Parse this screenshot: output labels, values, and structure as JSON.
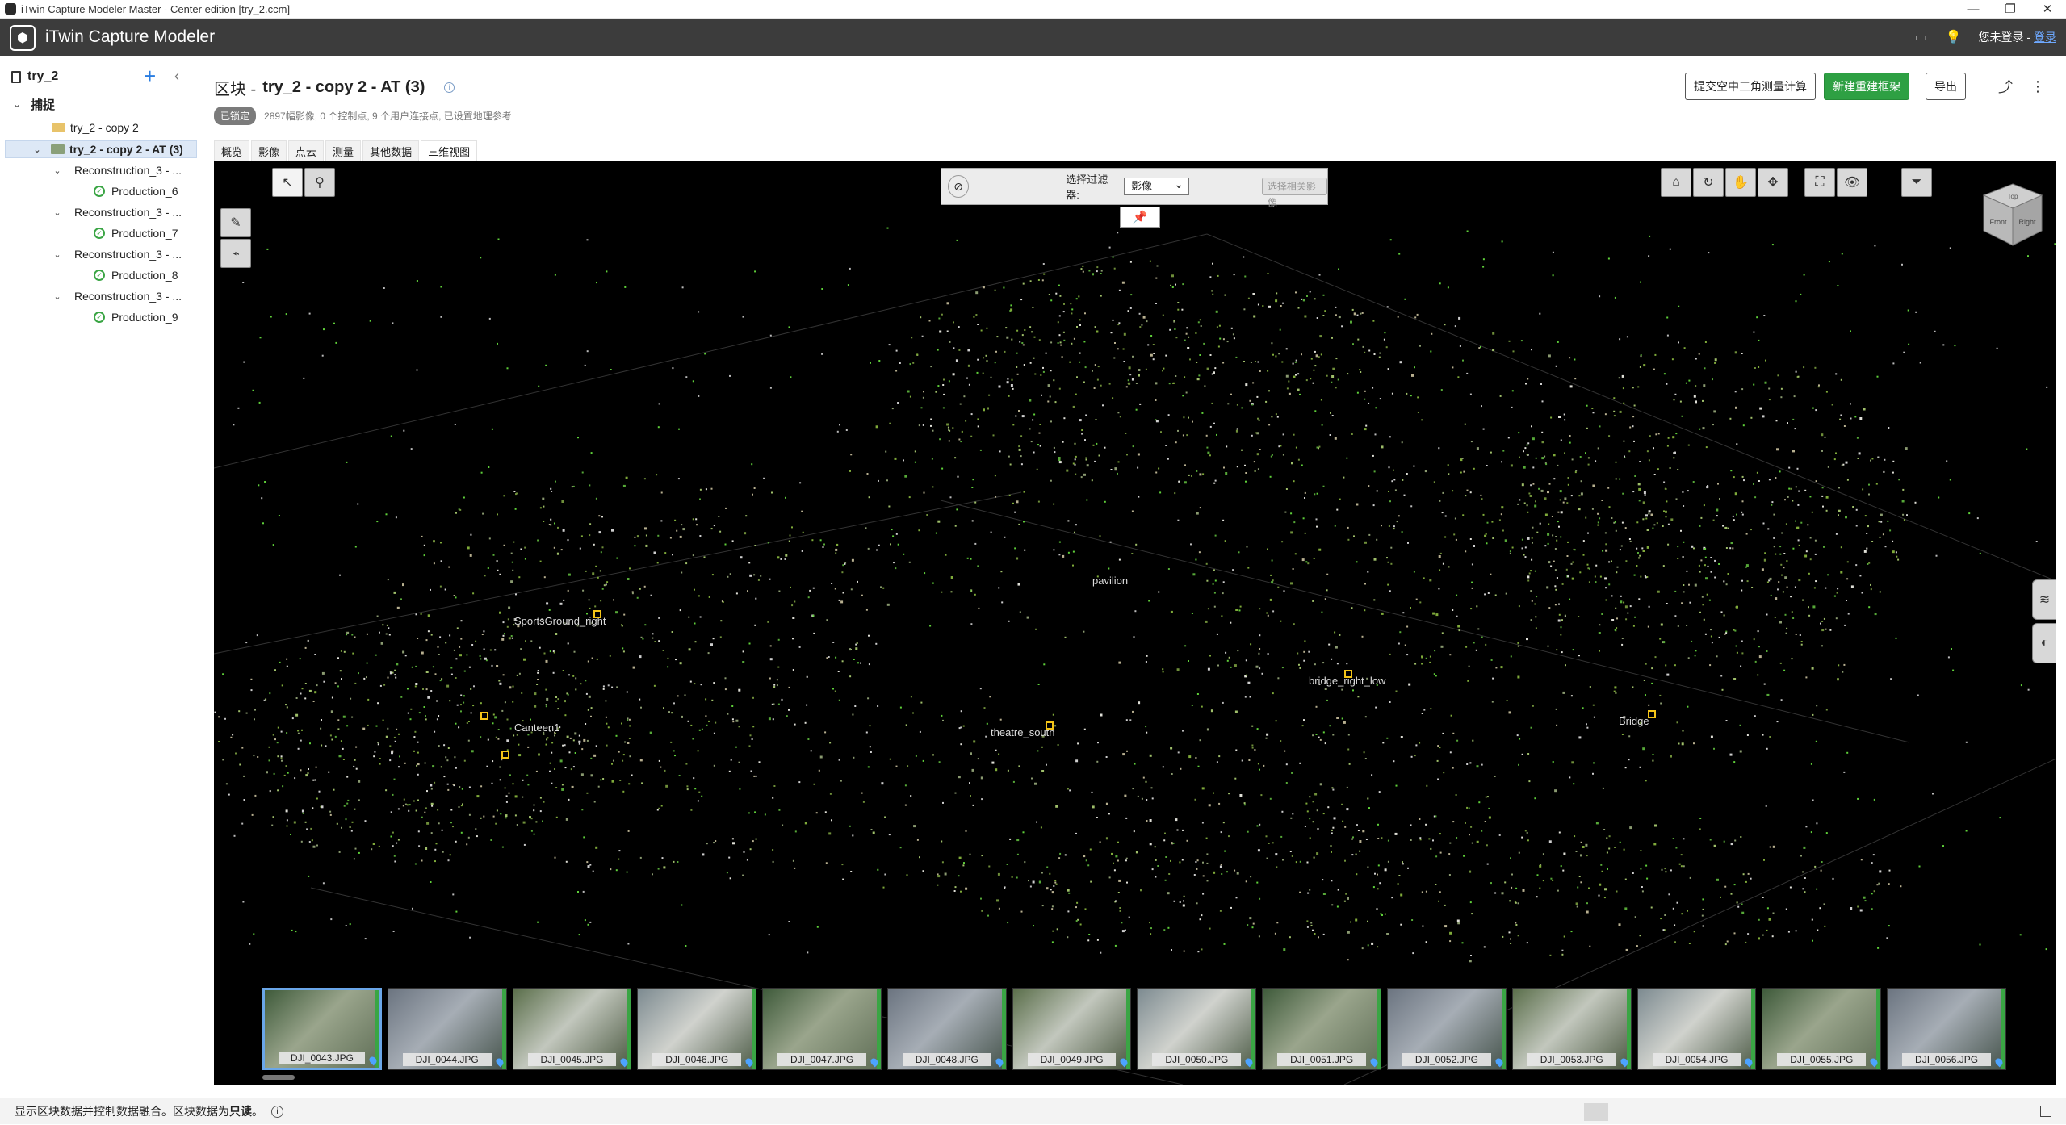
{
  "window": {
    "title": "iTwin Capture Modeler Master - Center edition [try_2.ccm]",
    "controls": [
      "—",
      "❐",
      "✕"
    ]
  },
  "header": {
    "logo_text": "⬢",
    "app_name": "iTwin Capture Modeler",
    "login_prefix": "您未登录 - ",
    "login_link": "登录"
  },
  "sidebar": {
    "project_name": "try_2",
    "add_symbol": "+",
    "collapse_symbol": "‹",
    "tree": [
      {
        "label": "捕捉",
        "level": 0,
        "type": "group"
      },
      {
        "label": "try_2 - copy 2",
        "level": 1,
        "type": "folder"
      },
      {
        "label": "try_2 - copy 2 - AT (3)",
        "level": 1,
        "type": "block",
        "selected": true
      },
      {
        "label": "Reconstruction_3 - ...",
        "level": 2,
        "type": "recon"
      },
      {
        "label": "Production_6",
        "level": 3,
        "type": "production"
      },
      {
        "label": "Reconstruction_3 - ...",
        "level": 2,
        "type": "recon"
      },
      {
        "label": "Production_7",
        "level": 3,
        "type": "production"
      },
      {
        "label": "Reconstruction_3 - ...",
        "level": 2,
        "type": "recon"
      },
      {
        "label": "Production_8",
        "level": 3,
        "type": "production"
      },
      {
        "label": "Reconstruction_3 - ...",
        "level": 2,
        "type": "recon"
      },
      {
        "label": "Production_9",
        "level": 3,
        "type": "production"
      }
    ]
  },
  "block": {
    "title_prefix": "区块 -",
    "title": "try_2 - copy 2 - AT (3)",
    "status_badge": "已锁定",
    "summary": "2897幅影像, 0 个控制点, 9 个用户连接点, 已设置地理参考"
  },
  "actions": {
    "submit_at": "提交空中三角测量计算",
    "new_recon": "新建重建框架",
    "export": "导出"
  },
  "tabs": [
    "概览",
    "影像",
    "点云",
    "测量",
    "其他数据",
    "三维视图"
  ],
  "active_tab": 5,
  "viewer": {
    "filter_label": "选择过滤器:",
    "filter_value": "影像",
    "filter_button": "选择相关影像",
    "labels": [
      {
        "text": "SportsGround_right"
      },
      {
        "text": "pavilion"
      },
      {
        "text": "bridge_right_low"
      },
      {
        "text": "Canteen1"
      },
      {
        "text": "theatre_south"
      },
      {
        "text": "Bridge"
      }
    ],
    "navcube": {
      "top": "Top",
      "front": "Front",
      "right": "Right"
    }
  },
  "filmstrip": [
    {
      "name": "DJI_0043.JPG",
      "selected": true
    },
    {
      "name": "DJI_0044.JPG"
    },
    {
      "name": "DJI_0045.JPG"
    },
    {
      "name": "DJI_0046.JPG"
    },
    {
      "name": "DJI_0047.JPG"
    },
    {
      "name": "DJI_0048.JPG"
    },
    {
      "name": "DJI_0049.JPG"
    },
    {
      "name": "DJI_0050.JPG"
    },
    {
      "name": "DJI_0051.JPG"
    },
    {
      "name": "DJI_0052.JPG"
    },
    {
      "name": "DJI_0053.JPG"
    },
    {
      "name": "DJI_0054.JPG"
    },
    {
      "name": "DJI_0055.JPG"
    },
    {
      "name": "DJI_0056.JPG"
    }
  ],
  "statusbar": {
    "text": "显示区块数据并控制数据融合。区块数据为",
    "bold": "只读",
    "end": "。"
  },
  "colors": {
    "accent": "#2a7de1",
    "green_button": "#2ea043",
    "header_bg": "#3c3c3c"
  }
}
